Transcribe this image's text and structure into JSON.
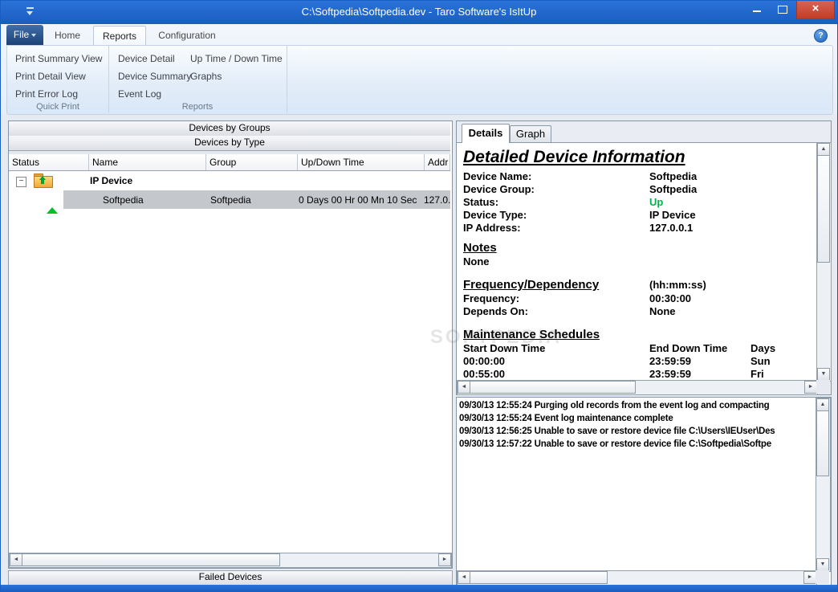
{
  "window": {
    "title": "C:\\Softpedia\\Softpedia.dev - Taro Software's IsItUp"
  },
  "accent": {
    "titlebar_blue": "#1d63c6",
    "close_red": "#c64a38",
    "status_up_green": "#00b44c",
    "selection_gray": "#c4c7cb"
  },
  "icons": {
    "help": "?",
    "close": "×",
    "expander_collapse": "−",
    "scroll_left": "◄",
    "scroll_right": "►",
    "scroll_up": "▲",
    "scroll_down": "▼"
  },
  "ribbon": {
    "file_tab_label": "File",
    "tabs": [
      {
        "label": "Home"
      },
      {
        "label": "Reports"
      },
      {
        "label": "Configuration"
      }
    ],
    "active_tab": "Reports",
    "quick_print_group": {
      "label": "Quick Print",
      "items": [
        "Print Summary View",
        "Print Detail View",
        "Print Error Log"
      ]
    },
    "reports_group": {
      "label": "Reports",
      "col1": [
        "Device Detail",
        "Device Summary",
        "Event Log"
      ],
      "col2": [
        "Up Time / Down Time",
        "Graphs"
      ]
    }
  },
  "device_list": {
    "view_buttons": [
      "Devices by Groups",
      "Devices by Type"
    ],
    "columns": [
      "Status",
      "Name",
      "Group",
      "Up/Down Time",
      "Addr"
    ],
    "group_row": {
      "label": "IP Device"
    },
    "device_row": {
      "name": "Softpedia",
      "group": "Softpedia",
      "updown_time": "0 Days 00 Hr 00 Mn 10 Sec",
      "address": "127.0."
    },
    "failed_devices_label": "Failed Devices"
  },
  "details_panel": {
    "tabs": [
      "Details",
      "Graph"
    ],
    "active_tab": "Details",
    "heading": "Detailed Device Information",
    "fields": [
      {
        "label": "Device Name:",
        "value": "Softpedia"
      },
      {
        "label": "Device Group:",
        "value": "Softpedia"
      },
      {
        "label": "Status:",
        "value": "Up"
      },
      {
        "label": "Device Type:",
        "value": "IP Device"
      },
      {
        "label": "IP Address:",
        "value": "127.0.0.1"
      }
    ],
    "notes": {
      "heading": "Notes",
      "value": "None"
    },
    "frequency": {
      "heading": "Frequency/Dependency",
      "unit": "(hh:mm:ss)",
      "rows": [
        {
          "label": "Frequency:",
          "value": "00:30:00"
        },
        {
          "label": "Depends On:",
          "value": "None"
        }
      ]
    },
    "maintenance": {
      "heading": "Maintenance Schedules",
      "columns": [
        "Start Down Time",
        "End Down Time",
        "Days"
      ],
      "rows": [
        {
          "start": "00:00:00",
          "end": "23:59:59",
          "days": "Sun"
        },
        {
          "start": "00:55:00",
          "end": "23:59:59",
          "days": "Fri"
        }
      ]
    }
  },
  "event_log": {
    "lines": [
      "09/30/13 12:55:24 Purging old records from the event log and compacting",
      "09/30/13 12:55:24 Event log maintenance complete",
      "09/30/13 12:56:25 Unable to save or restore device file C:\\Users\\IEUser\\Des",
      "09/30/13 12:57:22 Unable to save or restore device file C:\\Softpedia\\Softpe"
    ]
  },
  "watermark": "SOFTPEDIA"
}
